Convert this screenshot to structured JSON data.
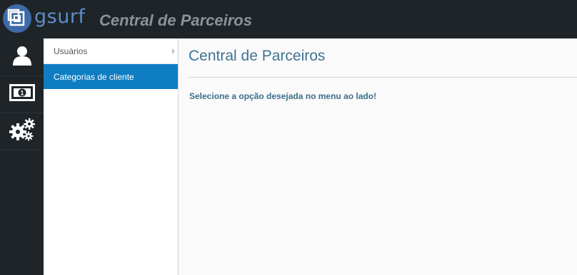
{
  "header": {
    "logo_text": "gsurf",
    "app_title": "Central de Parceiros"
  },
  "iconbar": {
    "items": [
      {
        "icon": "user-icon"
      },
      {
        "icon": "money-icon"
      },
      {
        "icon": "gears-icon"
      }
    ]
  },
  "submenu": {
    "items": [
      {
        "label": "Usuários",
        "has_arrow": true,
        "active": false
      },
      {
        "label": "Categorias de cliente",
        "active": true
      }
    ]
  },
  "main": {
    "title": "Central de Parceiros",
    "instruction": "Selecione a opção desejada no menu ao lado!"
  },
  "colors": {
    "topbar": "#1f2428",
    "active_item": "#0f7dc2",
    "title_text": "#3f7394"
  }
}
